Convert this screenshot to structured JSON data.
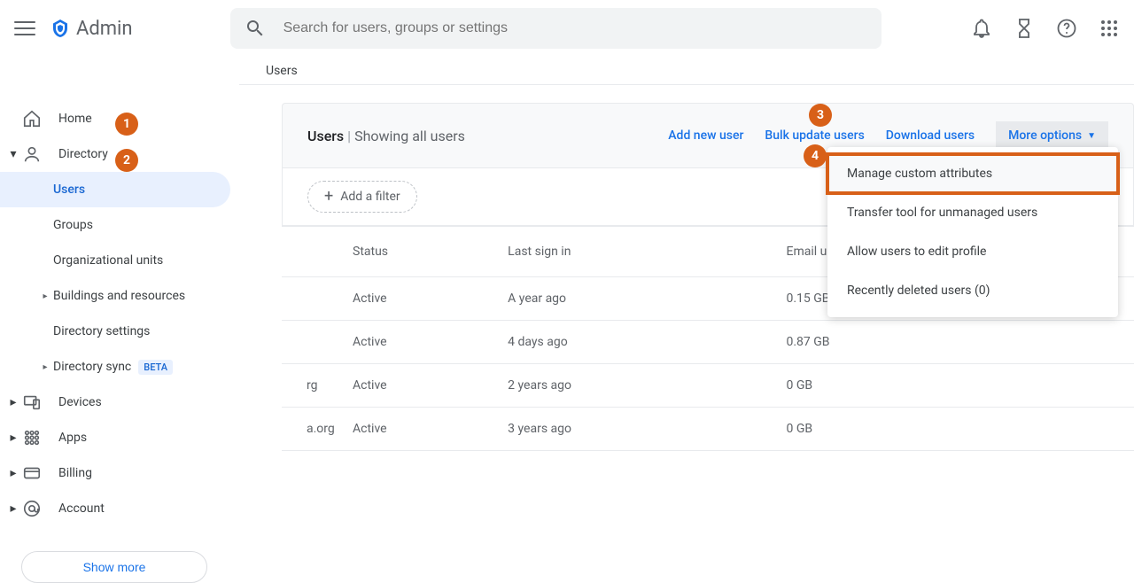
{
  "header": {
    "app_name": "Admin",
    "search_placeholder": "Search for users, groups or settings"
  },
  "breadcrumb": "Users",
  "sidebar": {
    "home": "Home",
    "directory": "Directory",
    "directory_children": {
      "users": "Users",
      "groups": "Groups",
      "org_units": "Organizational units",
      "buildings": "Buildings and resources",
      "dir_settings": "Directory settings",
      "dir_sync": "Directory sync",
      "beta_tag": "BETA"
    },
    "devices": "Devices",
    "apps": "Apps",
    "billing": "Billing",
    "account": "Account",
    "show_more": "Show more"
  },
  "panel": {
    "title_main": "Users",
    "title_sub": "Showing all users",
    "actions": {
      "add": "Add new user",
      "bulk": "Bulk update users",
      "download": "Download users",
      "more": "More options"
    },
    "add_filter": "Add a filter",
    "columns": {
      "status": "Status",
      "last_signin": "Last sign in",
      "email_usage": "Email usage"
    },
    "rows": [
      {
        "email": "",
        "status": "Active",
        "last_signin": "A year ago",
        "email_usage": "0.15 GB"
      },
      {
        "email": "",
        "status": "Active",
        "last_signin": "4 days ago",
        "email_usage": "0.87 GB"
      },
      {
        "email": "rg",
        "status": "Active",
        "last_signin": "2 years ago",
        "email_usage": "0 GB"
      },
      {
        "email": "a.org",
        "status": "Active",
        "last_signin": "3 years ago",
        "email_usage": "0 GB"
      }
    ]
  },
  "dropdown": {
    "items": [
      "Manage custom attributes",
      "Transfer tool for unmanaged users",
      "Allow users to edit profile",
      "Recently deleted users (0)"
    ]
  },
  "callouts": {
    "c1": "1",
    "c2": "2",
    "c3": "3",
    "c4": "4"
  }
}
